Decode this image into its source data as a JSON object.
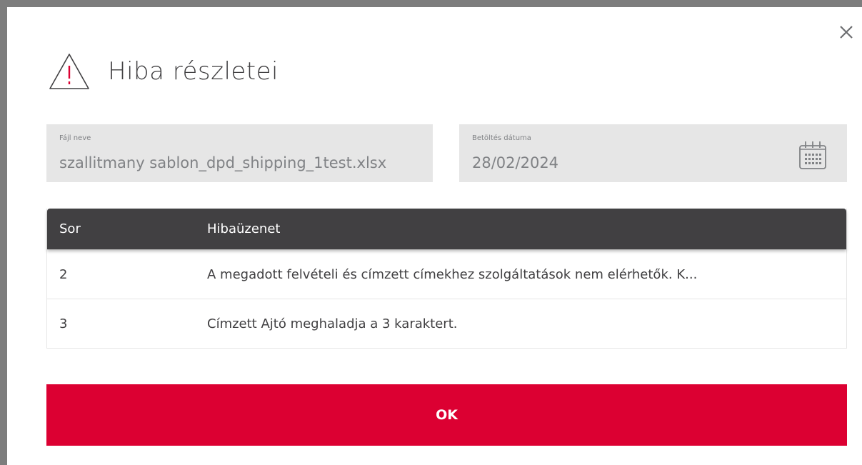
{
  "dialog": {
    "title": "Hiba részletei",
    "close_icon": "close-icon",
    "warning_icon": "warning-icon"
  },
  "fields": {
    "file_name": {
      "label": "Fájl neve",
      "value": "szallitmany sablon_dpd_shipping_1test.xlsx"
    },
    "load_date": {
      "label": "Betöltés dátuma",
      "value": "28/02/2024",
      "icon": "calendar-icon"
    }
  },
  "table": {
    "headers": [
      "Sor",
      "Hibaüzenet"
    ],
    "rows": [
      {
        "row": "2",
        "message": "A megadott felvételi és címzett címekhez szolgáltatások nem elérhetők. K..."
      },
      {
        "row": "3",
        "message": "Címzett Ajtó meghaladja a 3 karaktert."
      }
    ]
  },
  "actions": {
    "ok_label": "OK"
  },
  "colors": {
    "accent": "#dc0032",
    "header": "#414042",
    "field_bg": "#e6e6e6",
    "warning": "#dc0032"
  }
}
